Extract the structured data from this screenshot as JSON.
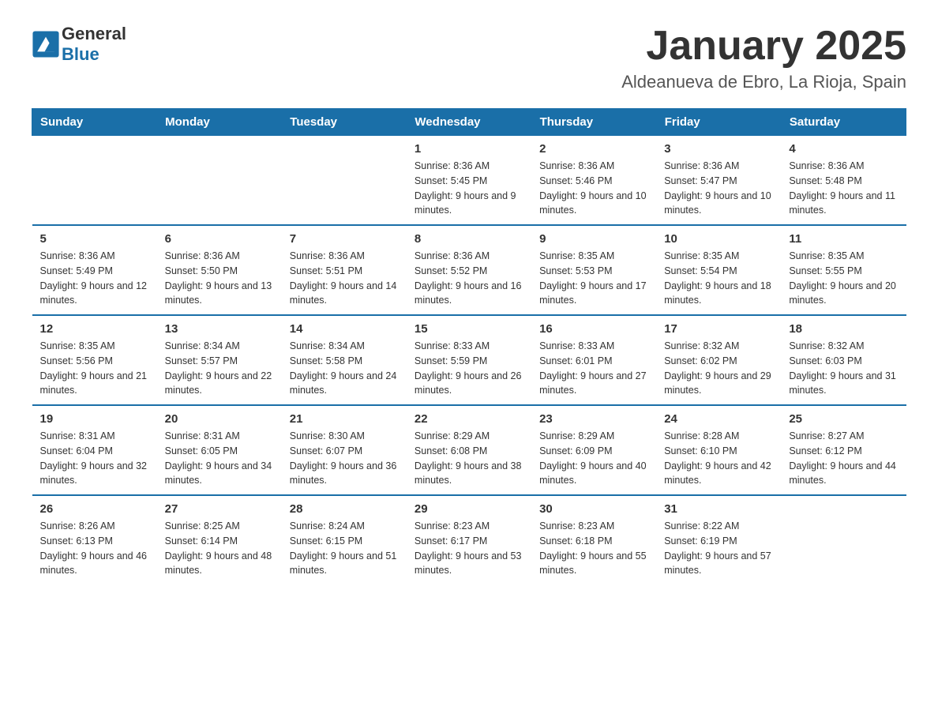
{
  "header": {
    "logo_text_general": "General",
    "logo_text_blue": "Blue",
    "month_title": "January 2025",
    "location": "Aldeanueva de Ebro, La Rioja, Spain"
  },
  "weekdays": [
    "Sunday",
    "Monday",
    "Tuesday",
    "Wednesday",
    "Thursday",
    "Friday",
    "Saturday"
  ],
  "weeks": [
    [
      {
        "day": "",
        "info": ""
      },
      {
        "day": "",
        "info": ""
      },
      {
        "day": "",
        "info": ""
      },
      {
        "day": "1",
        "info": "Sunrise: 8:36 AM\nSunset: 5:45 PM\nDaylight: 9 hours and 9 minutes."
      },
      {
        "day": "2",
        "info": "Sunrise: 8:36 AM\nSunset: 5:46 PM\nDaylight: 9 hours and 10 minutes."
      },
      {
        "day": "3",
        "info": "Sunrise: 8:36 AM\nSunset: 5:47 PM\nDaylight: 9 hours and 10 minutes."
      },
      {
        "day": "4",
        "info": "Sunrise: 8:36 AM\nSunset: 5:48 PM\nDaylight: 9 hours and 11 minutes."
      }
    ],
    [
      {
        "day": "5",
        "info": "Sunrise: 8:36 AM\nSunset: 5:49 PM\nDaylight: 9 hours and 12 minutes."
      },
      {
        "day": "6",
        "info": "Sunrise: 8:36 AM\nSunset: 5:50 PM\nDaylight: 9 hours and 13 minutes."
      },
      {
        "day": "7",
        "info": "Sunrise: 8:36 AM\nSunset: 5:51 PM\nDaylight: 9 hours and 14 minutes."
      },
      {
        "day": "8",
        "info": "Sunrise: 8:36 AM\nSunset: 5:52 PM\nDaylight: 9 hours and 16 minutes."
      },
      {
        "day": "9",
        "info": "Sunrise: 8:35 AM\nSunset: 5:53 PM\nDaylight: 9 hours and 17 minutes."
      },
      {
        "day": "10",
        "info": "Sunrise: 8:35 AM\nSunset: 5:54 PM\nDaylight: 9 hours and 18 minutes."
      },
      {
        "day": "11",
        "info": "Sunrise: 8:35 AM\nSunset: 5:55 PM\nDaylight: 9 hours and 20 minutes."
      }
    ],
    [
      {
        "day": "12",
        "info": "Sunrise: 8:35 AM\nSunset: 5:56 PM\nDaylight: 9 hours and 21 minutes."
      },
      {
        "day": "13",
        "info": "Sunrise: 8:34 AM\nSunset: 5:57 PM\nDaylight: 9 hours and 22 minutes."
      },
      {
        "day": "14",
        "info": "Sunrise: 8:34 AM\nSunset: 5:58 PM\nDaylight: 9 hours and 24 minutes."
      },
      {
        "day": "15",
        "info": "Sunrise: 8:33 AM\nSunset: 5:59 PM\nDaylight: 9 hours and 26 minutes."
      },
      {
        "day": "16",
        "info": "Sunrise: 8:33 AM\nSunset: 6:01 PM\nDaylight: 9 hours and 27 minutes."
      },
      {
        "day": "17",
        "info": "Sunrise: 8:32 AM\nSunset: 6:02 PM\nDaylight: 9 hours and 29 minutes."
      },
      {
        "day": "18",
        "info": "Sunrise: 8:32 AM\nSunset: 6:03 PM\nDaylight: 9 hours and 31 minutes."
      }
    ],
    [
      {
        "day": "19",
        "info": "Sunrise: 8:31 AM\nSunset: 6:04 PM\nDaylight: 9 hours and 32 minutes."
      },
      {
        "day": "20",
        "info": "Sunrise: 8:31 AM\nSunset: 6:05 PM\nDaylight: 9 hours and 34 minutes."
      },
      {
        "day": "21",
        "info": "Sunrise: 8:30 AM\nSunset: 6:07 PM\nDaylight: 9 hours and 36 minutes."
      },
      {
        "day": "22",
        "info": "Sunrise: 8:29 AM\nSunset: 6:08 PM\nDaylight: 9 hours and 38 minutes."
      },
      {
        "day": "23",
        "info": "Sunrise: 8:29 AM\nSunset: 6:09 PM\nDaylight: 9 hours and 40 minutes."
      },
      {
        "day": "24",
        "info": "Sunrise: 8:28 AM\nSunset: 6:10 PM\nDaylight: 9 hours and 42 minutes."
      },
      {
        "day": "25",
        "info": "Sunrise: 8:27 AM\nSunset: 6:12 PM\nDaylight: 9 hours and 44 minutes."
      }
    ],
    [
      {
        "day": "26",
        "info": "Sunrise: 8:26 AM\nSunset: 6:13 PM\nDaylight: 9 hours and 46 minutes."
      },
      {
        "day": "27",
        "info": "Sunrise: 8:25 AM\nSunset: 6:14 PM\nDaylight: 9 hours and 48 minutes."
      },
      {
        "day": "28",
        "info": "Sunrise: 8:24 AM\nSunset: 6:15 PM\nDaylight: 9 hours and 51 minutes."
      },
      {
        "day": "29",
        "info": "Sunrise: 8:23 AM\nSunset: 6:17 PM\nDaylight: 9 hours and 53 minutes."
      },
      {
        "day": "30",
        "info": "Sunrise: 8:23 AM\nSunset: 6:18 PM\nDaylight: 9 hours and 55 minutes."
      },
      {
        "day": "31",
        "info": "Sunrise: 8:22 AM\nSunset: 6:19 PM\nDaylight: 9 hours and 57 minutes."
      },
      {
        "day": "",
        "info": ""
      }
    ]
  ]
}
